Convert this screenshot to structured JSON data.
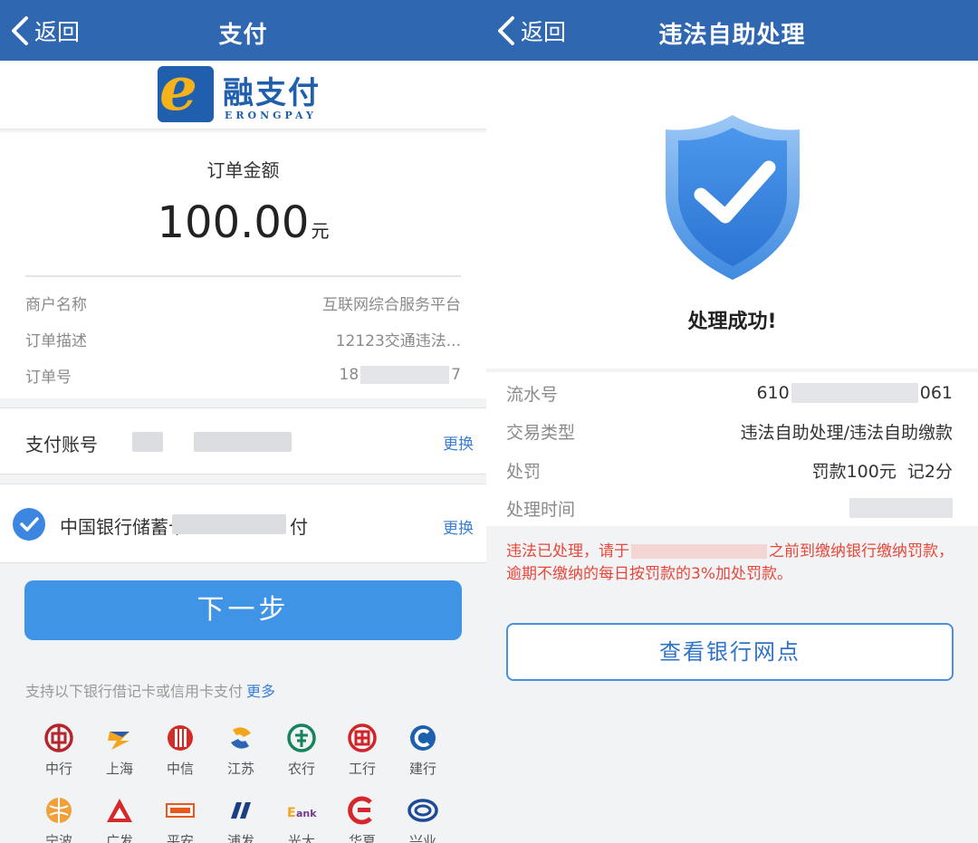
{
  "left": {
    "nav": {
      "back_label": "返回",
      "title": "支付"
    },
    "logo": {
      "mark": "e",
      "cn": "融支付",
      "en": "ERONGPAY"
    },
    "order": {
      "label": "订单金额",
      "amount": "100.00",
      "unit": "元"
    },
    "info": [
      {
        "key": "商户名称",
        "value": "互联网综合服务平台"
      },
      {
        "key": "订单描述",
        "value": "12123交通违法..."
      },
      {
        "key": "订单号",
        "value_prefix": "18",
        "value_suffix": "7"
      }
    ],
    "account": {
      "label": "支付账号",
      "change_label": "更换"
    },
    "bank": {
      "name": "中国银行储蓄卡",
      "suffix": "付",
      "change_label": "更换",
      "checked": true
    },
    "next_button": "下一步",
    "support": {
      "text": "支持以下银行借记卡或信用卡支付",
      "more": "更多"
    },
    "banks": [
      {
        "name": "中行",
        "icon": "boc-icon",
        "color": "#b3262c"
      },
      {
        "name": "上海",
        "icon": "bosc-icon",
        "color": "#f2a51d"
      },
      {
        "name": "中信",
        "icon": "citic-icon",
        "color": "#d22c26"
      },
      {
        "name": "江苏",
        "icon": "jsb-icon",
        "color": "#2a66b3"
      },
      {
        "name": "农行",
        "icon": "abc-icon",
        "color": "#13845b"
      },
      {
        "name": "工行",
        "icon": "icbc-icon",
        "color": "#d0242a"
      },
      {
        "name": "建行",
        "icon": "ccb-icon",
        "color": "#1e5fb0"
      },
      {
        "name": "宁波",
        "icon": "nbcb-icon",
        "color": "#f1a03a"
      },
      {
        "name": "广发",
        "icon": "cgb-icon",
        "color": "#d42a2a"
      },
      {
        "name": "平安",
        "icon": "pingan-icon",
        "color": "#e8581c"
      },
      {
        "name": "浦发",
        "icon": "spdb-icon",
        "color": "#1b3e85"
      },
      {
        "name": "光大",
        "icon": "ceb-icon",
        "color": "#6f3a8e"
      },
      {
        "name": "华夏",
        "icon": "hxb-icon",
        "color": "#d6252b"
      },
      {
        "name": "兴业",
        "icon": "cib-icon",
        "color": "#1c4a97"
      }
    ]
  },
  "right": {
    "nav": {
      "back_label": "返回",
      "title": "违法自助处理"
    },
    "success_text": "处理成功!",
    "details": [
      {
        "key": "流水号",
        "value_prefix": "610",
        "value_suffix": "061"
      },
      {
        "key": "交易类型",
        "value": "违法自助处理/违法自助缴款"
      },
      {
        "key": "处罚",
        "value": "罚款100元  记2分"
      },
      {
        "key": "处理时间"
      }
    ],
    "notice": {
      "part1": "违法已处理，请于",
      "part2": "之前到缴纳银行缴纳罚款，逾期不缴纳的每日按罚款的3%加处罚款。"
    },
    "bank_button": "查看银行网点"
  },
  "colors": {
    "nav_bg": "#2f67b1",
    "accent": "#3f94e6",
    "link": "#3a7fd6",
    "warning": "#e8473a"
  }
}
